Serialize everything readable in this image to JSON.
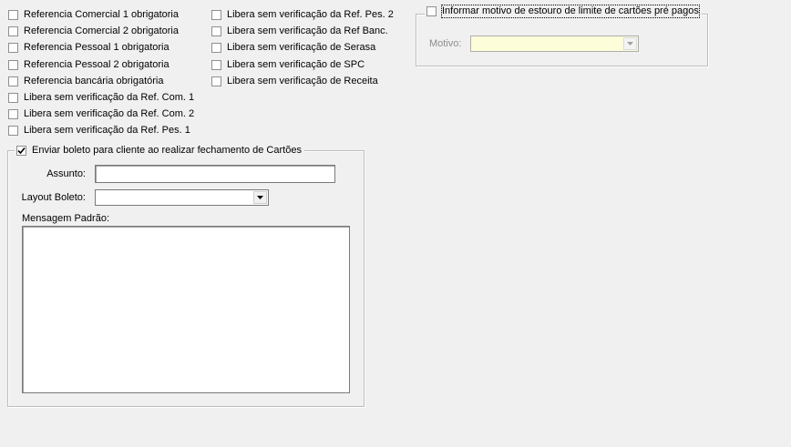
{
  "col1": [
    {
      "label": "Referencia Comercial 1 obrigatoria",
      "checked": false
    },
    {
      "label": "Referencia Comercial 2 obrigatoria",
      "checked": false
    },
    {
      "label": "Referencia Pessoal 1 obrigatoria",
      "checked": false
    },
    {
      "label": "Referencia Pessoal 2 obrigatoria",
      "checked": false
    },
    {
      "label": "Referencia bancária obrigatória",
      "checked": false
    },
    {
      "label": "Libera sem verificação da Ref. Com. 1",
      "checked": false
    },
    {
      "label": "Libera sem verificação da Ref. Com. 2",
      "checked": false
    },
    {
      "label": "Libera sem verificação da Ref. Pes. 1",
      "checked": false
    }
  ],
  "col2": [
    {
      "label": "Libera sem verificação da Ref. Pes. 2",
      "checked": false
    },
    {
      "label": "Libera sem verificação da Ref Banc.",
      "checked": false
    },
    {
      "label": "Libera sem verificação de Serasa",
      "checked": false
    },
    {
      "label": "Libera sem verificação de SPC",
      "checked": false
    },
    {
      "label": "Libera sem verificação de Receita",
      "checked": false
    }
  ],
  "motivo_group": {
    "checkbox_label": "Informar motivo de estouro de limite de cartões pré pagos",
    "checked": false,
    "motivo_label": "Motivo:",
    "motivo_value": ""
  },
  "boleto_group": {
    "checkbox_label": "Enviar boleto para cliente ao realizar fechamento de Cartões",
    "checked": true,
    "assunto_label": "Assunto:",
    "assunto_value": "",
    "layout_label": "Layout Boleto:",
    "layout_value": "",
    "mensagem_label": "Mensagem Padrão:",
    "mensagem_value": ""
  }
}
